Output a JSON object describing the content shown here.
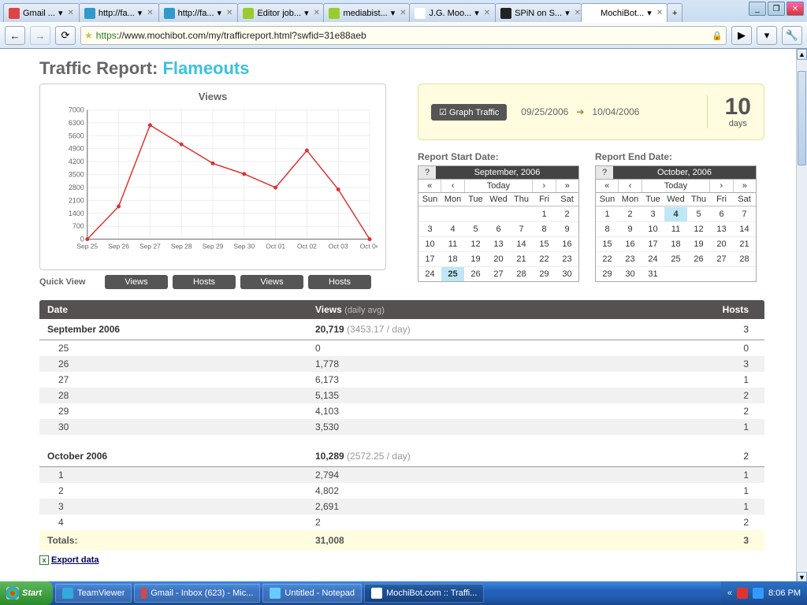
{
  "window": {
    "min": "_",
    "max": "❐",
    "close": "✕"
  },
  "tabs": [
    {
      "label": "Gmail ...",
      "color": "#d44"
    },
    {
      "label": "http://fa...",
      "color": "#39c"
    },
    {
      "label": "http://fa...",
      "color": "#39c"
    },
    {
      "label": "Editor job...",
      "color": "#9c3"
    },
    {
      "label": "mediabist...",
      "color": "#9c3"
    },
    {
      "label": "J.G. Moo...",
      "color": "#fff"
    },
    {
      "label": "SPiN on S...",
      "color": "#222"
    },
    {
      "label": "MochiBot...",
      "color": "#fff",
      "active": true
    }
  ],
  "url": {
    "prefix": "https",
    "rest": "://www.mochibot.com/my/trafficreport.html?swfid=31e88aeb"
  },
  "page": {
    "title_a": "Traffic Report: ",
    "title_b": "Flameouts",
    "graph_btn": "☑ Graph Traffic",
    "date_from": "09/25/2006",
    "date_to": "10/04/2006",
    "days_n": "10",
    "days_l": "days",
    "quick": "Quick View",
    "qbtns": [
      "Views",
      "Hosts",
      "Views",
      "Hosts"
    ],
    "start_lbl": "Report Start Date:",
    "end_lbl": "Report End Date:",
    "cal1": {
      "month": "September, 2006",
      "today": "Today",
      "sel": "25",
      "weeks": [
        [
          "",
          "",
          "",
          "",
          "",
          "1",
          "2"
        ],
        [
          "3",
          "4",
          "5",
          "6",
          "7",
          "8",
          "9"
        ],
        [
          "10",
          "11",
          "12",
          "13",
          "14",
          "15",
          "16"
        ],
        [
          "17",
          "18",
          "19",
          "20",
          "21",
          "22",
          "23"
        ],
        [
          "24",
          "25",
          "26",
          "27",
          "28",
          "29",
          "30"
        ]
      ]
    },
    "cal2": {
      "month": "October, 2006",
      "today": "Today",
      "sel": "4",
      "weeks": [
        [
          "1",
          "2",
          "3",
          "4",
          "5",
          "6",
          "7"
        ],
        [
          "8",
          "9",
          "10",
          "11",
          "12",
          "13",
          "14"
        ],
        [
          "15",
          "16",
          "17",
          "18",
          "19",
          "20",
          "21"
        ],
        [
          "22",
          "23",
          "24",
          "25",
          "26",
          "27",
          "28"
        ],
        [
          "29",
          "30",
          "31",
          "",
          "",
          "",
          ""
        ]
      ]
    },
    "daynames": [
      "Sun",
      "Mon",
      "Tue",
      "Wed",
      "Thu",
      "Fri",
      "Sat"
    ],
    "head": {
      "date": "Date",
      "views": "Views",
      "avg": "(daily avg)",
      "hosts": "Hosts"
    },
    "months": [
      {
        "name": "September 2006",
        "views": "20,719",
        "avg": "(3453.17 / day)",
        "hosts": "3",
        "rows": [
          {
            "d": "25",
            "v": "0",
            "h": "0"
          },
          {
            "d": "26",
            "v": "1,778",
            "h": "3"
          },
          {
            "d": "27",
            "v": "6,173",
            "h": "1"
          },
          {
            "d": "28",
            "v": "5,135",
            "h": "2"
          },
          {
            "d": "29",
            "v": "4,103",
            "h": "2"
          },
          {
            "d": "30",
            "v": "3,530",
            "h": "1"
          }
        ]
      },
      {
        "name": "October 2006",
        "views": "10,289",
        "avg": "(2572.25 / day)",
        "hosts": "2",
        "rows": [
          {
            "d": "1",
            "v": "2,794",
            "h": "1"
          },
          {
            "d": "2",
            "v": "4,802",
            "h": "1"
          },
          {
            "d": "3",
            "v": "2,691",
            "h": "1"
          },
          {
            "d": "4",
            "v": "2",
            "h": "2"
          }
        ]
      }
    ],
    "totals": {
      "label": "Totals:",
      "views": "31,008",
      "hosts": "3"
    },
    "export": "Export data"
  },
  "chart_data": {
    "type": "line",
    "title": "Views",
    "categories": [
      "Sep 25",
      "Sep 26",
      "Sep 27",
      "Sep 28",
      "Sep 29",
      "Sep 30",
      "Oct 01",
      "Oct 02",
      "Oct 03",
      "Oct 04"
    ],
    "values": [
      0,
      1778,
      6173,
      5135,
      4103,
      3530,
      2794,
      4802,
      2691,
      2
    ],
    "yticks": [
      0,
      700,
      1400,
      2100,
      2800,
      3500,
      4200,
      4900,
      5600,
      6300,
      7000
    ],
    "ylim": [
      0,
      7000
    ]
  },
  "taskbar": {
    "start": "Start",
    "items": [
      {
        "label": "TeamViewer",
        "color": "#3ad"
      },
      {
        "label": "Gmail - Inbox (623) - Mic...",
        "color": "#d44"
      },
      {
        "label": "Untitled - Notepad",
        "color": "#6cf"
      },
      {
        "label": "MochiBot.com :: Traffi...",
        "color": "#fff",
        "active": true
      }
    ],
    "time": "8:06 PM"
  }
}
